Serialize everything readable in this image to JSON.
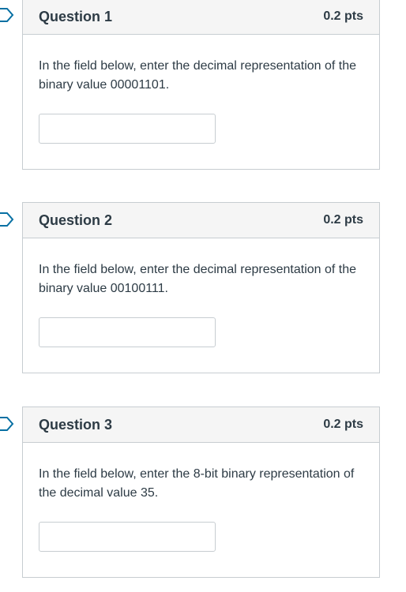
{
  "questions": [
    {
      "title": "Question 1",
      "points": "0.2 pts",
      "text": "In the field below, enter the decimal representation of the binary value 00001101.",
      "answer": ""
    },
    {
      "title": "Question 2",
      "points": "0.2 pts",
      "text": "In the field below, enter the decimal representation of the binary value 00100111.",
      "answer": ""
    },
    {
      "title": "Question 3",
      "points": "0.2 pts",
      "text": "In the field below, enter the 8-bit binary representation of the decimal value 35.",
      "answer": ""
    }
  ],
  "icons": {
    "flag": "flag-icon"
  },
  "colors": {
    "border": "#c7cdd1",
    "header_bg": "#f5f5f5",
    "text": "#2d3b45",
    "flag": "#0770a3"
  }
}
